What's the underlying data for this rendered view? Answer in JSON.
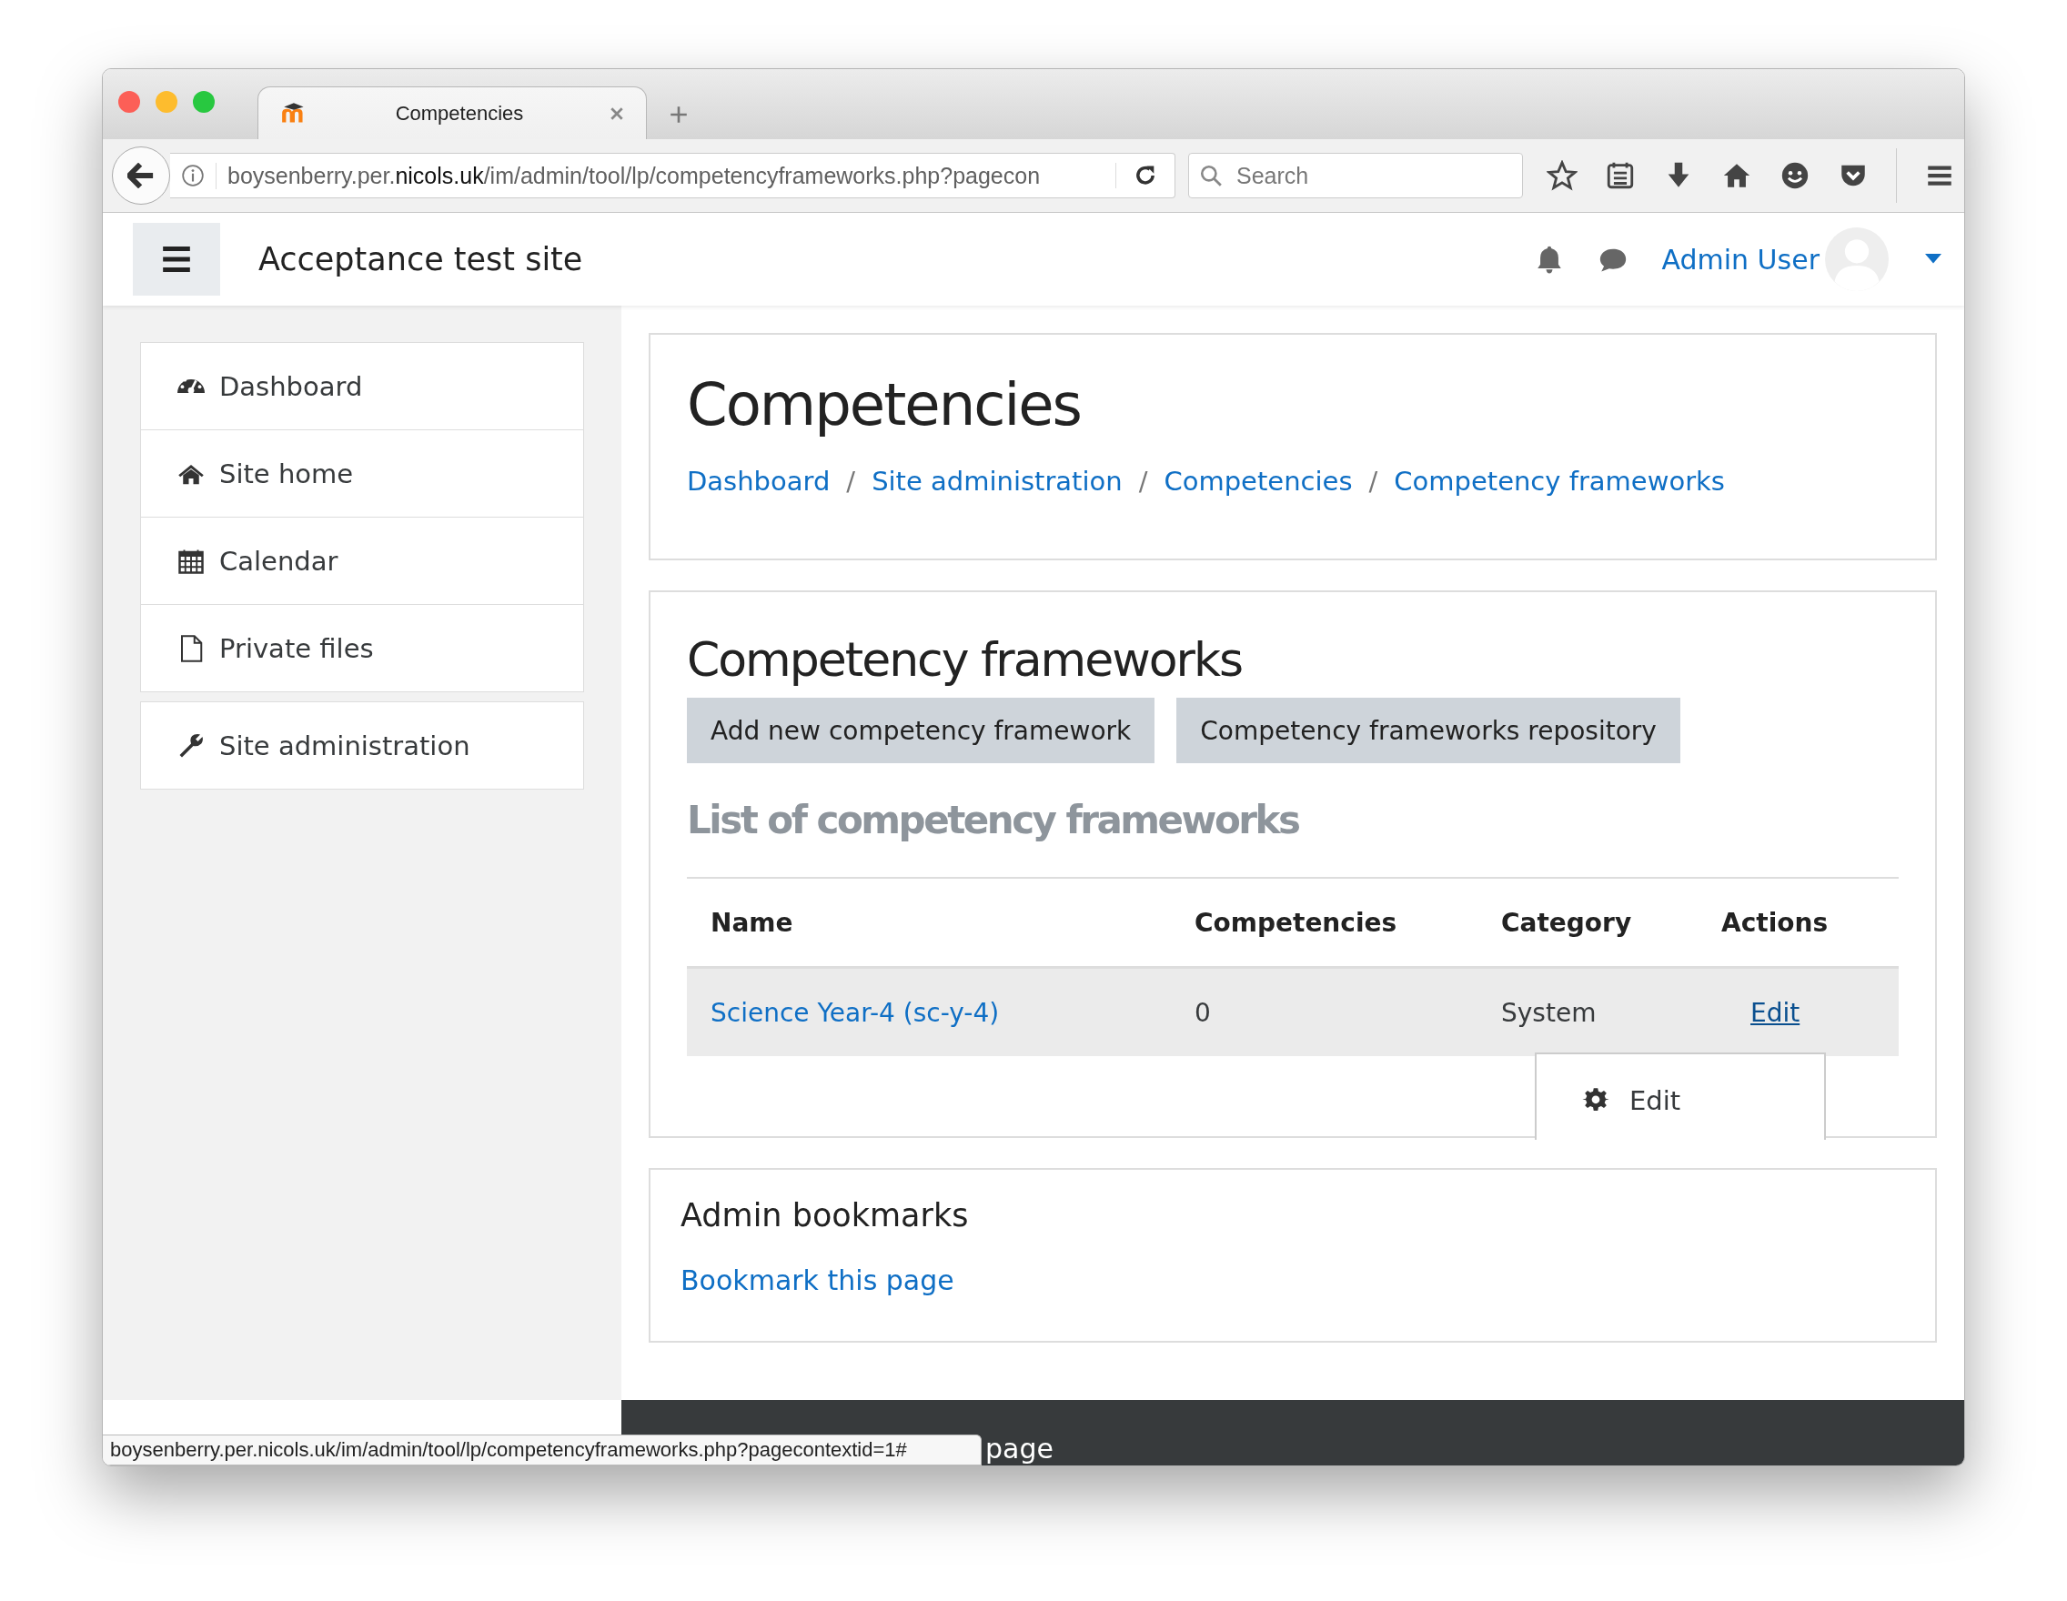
{
  "browser": {
    "tab_title": "Competencies",
    "url_prefix": "boysenberry.per.",
    "url_domain": "nicols.uk",
    "url_path": "/im/admin/tool/lp/competencyframeworks.php?pagecon",
    "search_placeholder": "Search"
  },
  "navbar": {
    "site_name": "Acceptance test site",
    "user_name": "Admin User"
  },
  "sidebar": {
    "groups": [
      [
        {
          "label": "Dashboard"
        },
        {
          "label": "Site home"
        },
        {
          "label": "Calendar"
        },
        {
          "label": "Private files"
        }
      ],
      [
        {
          "label": "Site administration"
        }
      ]
    ]
  },
  "page_header": {
    "title": "Competencies",
    "breadcrumbs": [
      "Dashboard",
      "Site administration",
      "Competencies",
      "Competency frameworks"
    ],
    "separator": "/"
  },
  "frameworks": {
    "heading": "Competency frameworks",
    "buttons": [
      "Add new competency framework",
      "Competency frameworks repository"
    ],
    "list_heading": "List of competency frameworks",
    "table": {
      "columns": [
        "Name",
        "Competencies",
        "Category",
        "Actions"
      ],
      "rows": [
        {
          "name": "Science Year-4 (sc-y-4)",
          "competencies": "0",
          "category": "System",
          "action": "Edit"
        }
      ]
    },
    "menu": {
      "items": [
        "Edit"
      ]
    }
  },
  "bookmarks": {
    "title": "Admin bookmarks",
    "link": "Bookmark this page"
  },
  "footer": {
    "text": "page"
  },
  "status_bar": {
    "url": "boysenberry.per.nicols.uk/im/admin/tool/lp/competencyframeworks.php?pagecontextid=1#"
  }
}
